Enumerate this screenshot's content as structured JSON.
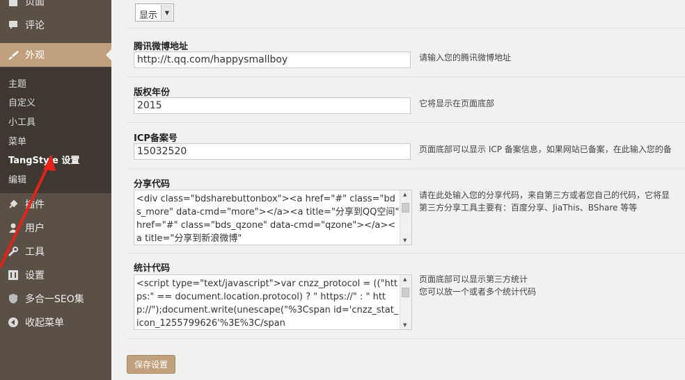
{
  "sidebar": {
    "items": [
      {
        "label": "页面",
        "icon": "page-icon"
      },
      {
        "label": "评论",
        "icon": "comment-icon"
      },
      {
        "label": "外观",
        "icon": "brush-icon"
      },
      {
        "label": "插件",
        "icon": "plugin-icon"
      },
      {
        "label": "用户",
        "icon": "user-icon"
      },
      {
        "label": "工具",
        "icon": "wrench-icon"
      },
      {
        "label": "设置",
        "icon": "settings-icon"
      },
      {
        "label": "多合一SEO集",
        "icon": "shield-icon"
      },
      {
        "label": "收起菜单",
        "icon": "collapse-icon"
      }
    ],
    "submenu": [
      "主题",
      "自定义",
      "小工具",
      "菜单",
      "TangStyle 设置",
      "编辑"
    ],
    "active_color": "#c1a07e",
    "bg_color": "#5a5046"
  },
  "form": {
    "display_select": {
      "value": "显示"
    },
    "weibo": {
      "label": "腾讯微博地址",
      "value": "http://t.qq.com/happysmallboy",
      "desc": "请输入您的腾讯微博地址"
    },
    "copyright": {
      "label": "版权年份",
      "value": "2015",
      "desc": "它将显示在页面底部"
    },
    "icp": {
      "label": "ICP备案号",
      "value": "15032520",
      "desc": "页面底部可以显示 ICP 备案信息，如果网站已备案，在此输入您的备"
    },
    "share": {
      "label": "分享代码",
      "value": "<div class=\"bdsharebuttonbox\"><a href=\"#\" class=\"bds_more\" data-cmd=\"more\"></a><a title=\"分享到QQ空间\" href=\"#\" class=\"bds_qzone\" data-cmd=\"qzone\"></a><a title=\"分享到新浪微博\"",
      "desc_line1": "请在此处输入您的分享代码，来自第三方或者您自己的代码，它将显",
      "desc_line2": "第三方分享工具主要有：百度分享、JiaThis、BShare 等等"
    },
    "stats": {
      "label": "统计代码",
      "value": "<script type=\"text/javascript\">var cnzz_protocol = ((\"https:\" == document.location.protocol) ? \" https://\" : \" http://\");document.write(unescape(\"%3Cspan id='cnzz_stat_icon_1255799626'%3E%3C/span",
      "desc_line1": "页面底部可以显示第三方统计",
      "desc_line2": "您可以放一个或者多个统计代码"
    },
    "save_label": "保存设置"
  }
}
